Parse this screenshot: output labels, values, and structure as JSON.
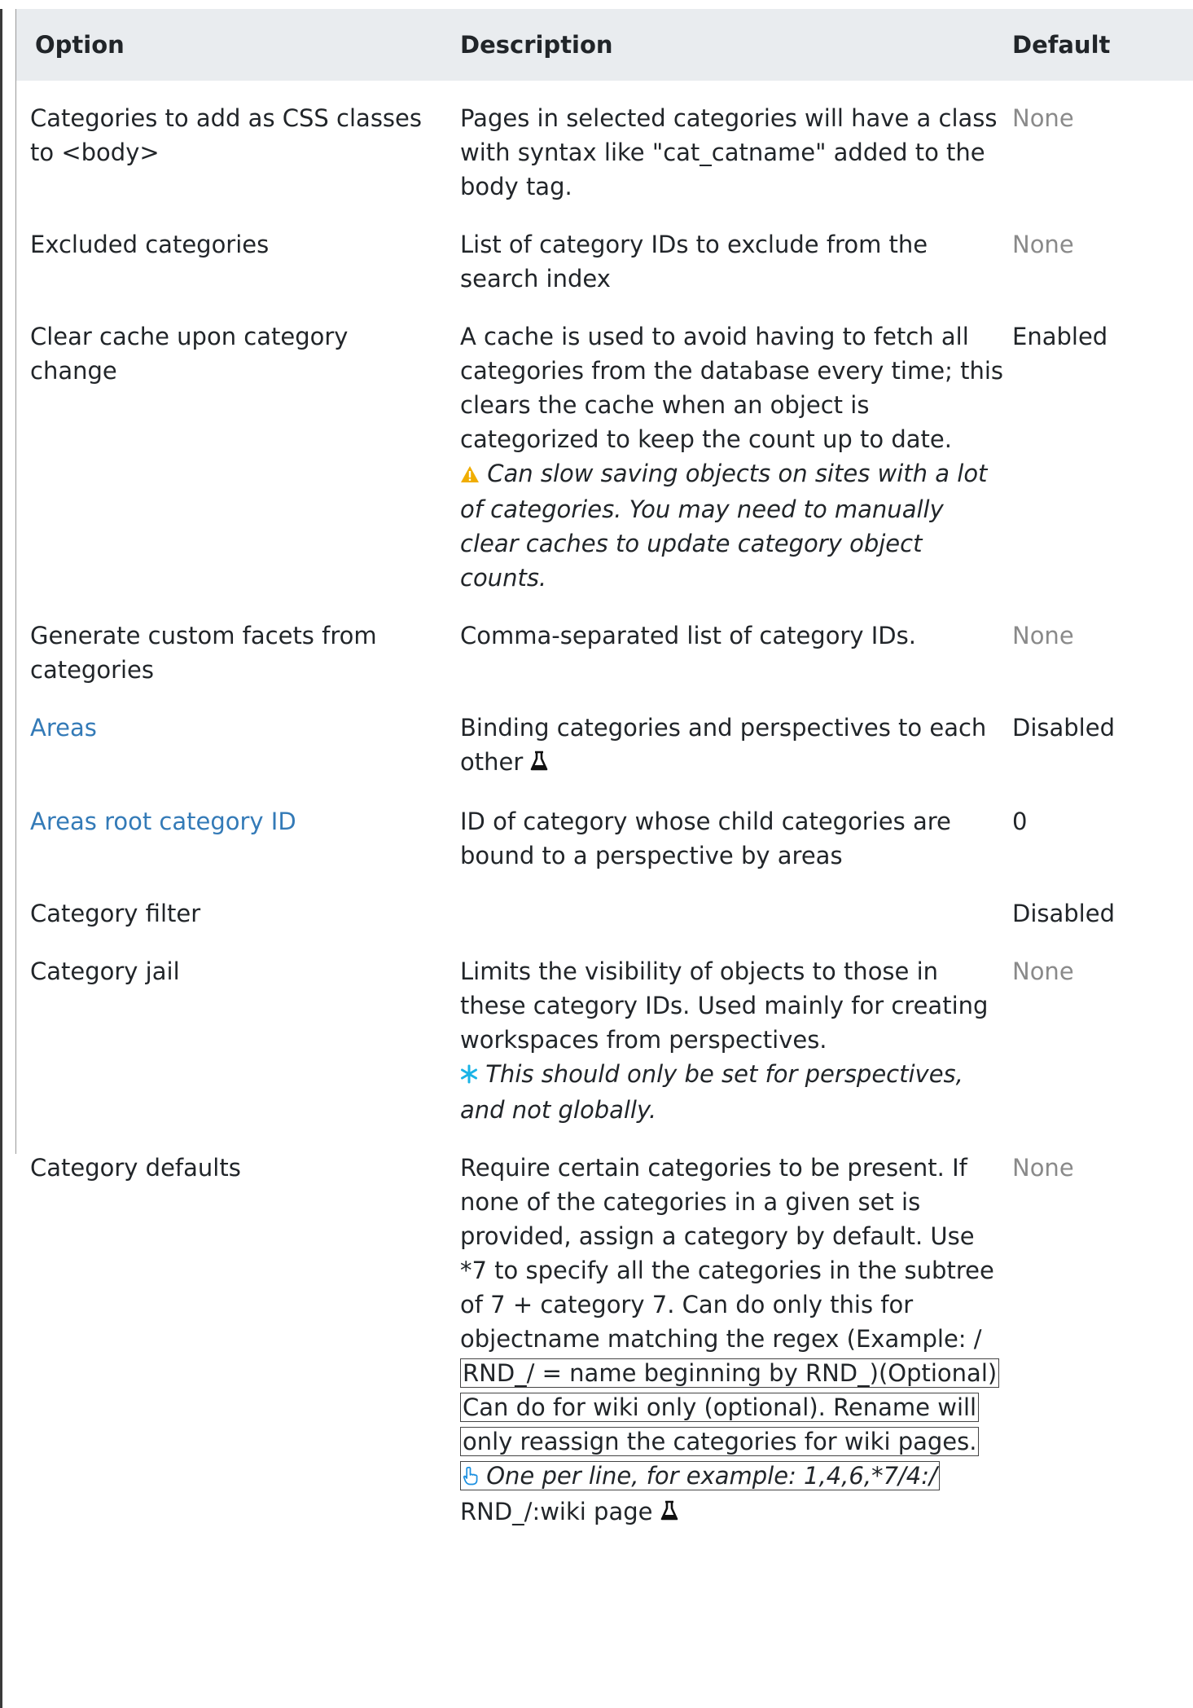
{
  "table": {
    "headers": {
      "option": "Option",
      "description": "Description",
      "default": "Default"
    },
    "rows": [
      {
        "option": "Categories to add as CSS classes to <body>",
        "description": "Pages in selected categories will have a class with syntax like \"cat_catname\" added to the body tag.",
        "default": "None"
      },
      {
        "option": "Excluded categories",
        "description": "List of category IDs to exclude from the search index",
        "default": "None"
      },
      {
        "option": "Clear cache upon category change",
        "description": "A cache is used to avoid having to fetch all categories from the database every time; this clears the cache when an object is categorized to keep the count up to date.",
        "note": "Can slow saving objects on sites with a lot of categories. You may need to manually clear caches to update category object counts.",
        "note_icon": "warning-icon",
        "default": "Enabled"
      },
      {
        "option": "Generate custom facets from categories",
        "description": "Comma-separated list of category IDs.",
        "default": "None"
      },
      {
        "option": "Areas",
        "description": "Binding categories and perspectives to each other",
        "description_icon": "flask-icon",
        "default": "Disabled"
      },
      {
        "option": "Areas root category ID",
        "description": "ID of category whose child categories are bound to a perspective by areas",
        "default": "0"
      },
      {
        "option": "Category filter",
        "description": "",
        "default": "Disabled"
      },
      {
        "option": "Category jail",
        "description": "Limits the visibility of objects to those in these category IDs. Used mainly for creating workspaces from perspectives.",
        "note": "This should only be set for perspectives, and not globally.",
        "note_icon": "asterisk-icon",
        "default": "None"
      },
      {
        "option": "Category defaults",
        "description": "Require certain categories to be present. If none of the categories in a given set is provided, assign a category by default. Use *7 to specify all the categories in the subtree of 7 + category 7. Can do only this for objectname matching the regex (Example: /",
        "description_boxed": "RND_/ = name beginning by RND_)(Optional) Can do for wiki only (optional). Rename will only reassign the categories for wiki pages.",
        "note": "One per line, for example: 1,4,6,*7/4:/",
        "note_icon": "hand-pointer-icon",
        "description_tail": "RND_/:wiki page",
        "description_icon": "flask-icon",
        "default": "None"
      }
    ]
  },
  "colors": {
    "header_bg": "#e9ecef",
    "link": "#337ab7",
    "muted": "#8a8a8a",
    "warning": "#f0ad00",
    "asterisk": "#1ab3e6",
    "hand": "#1a8fe0"
  }
}
